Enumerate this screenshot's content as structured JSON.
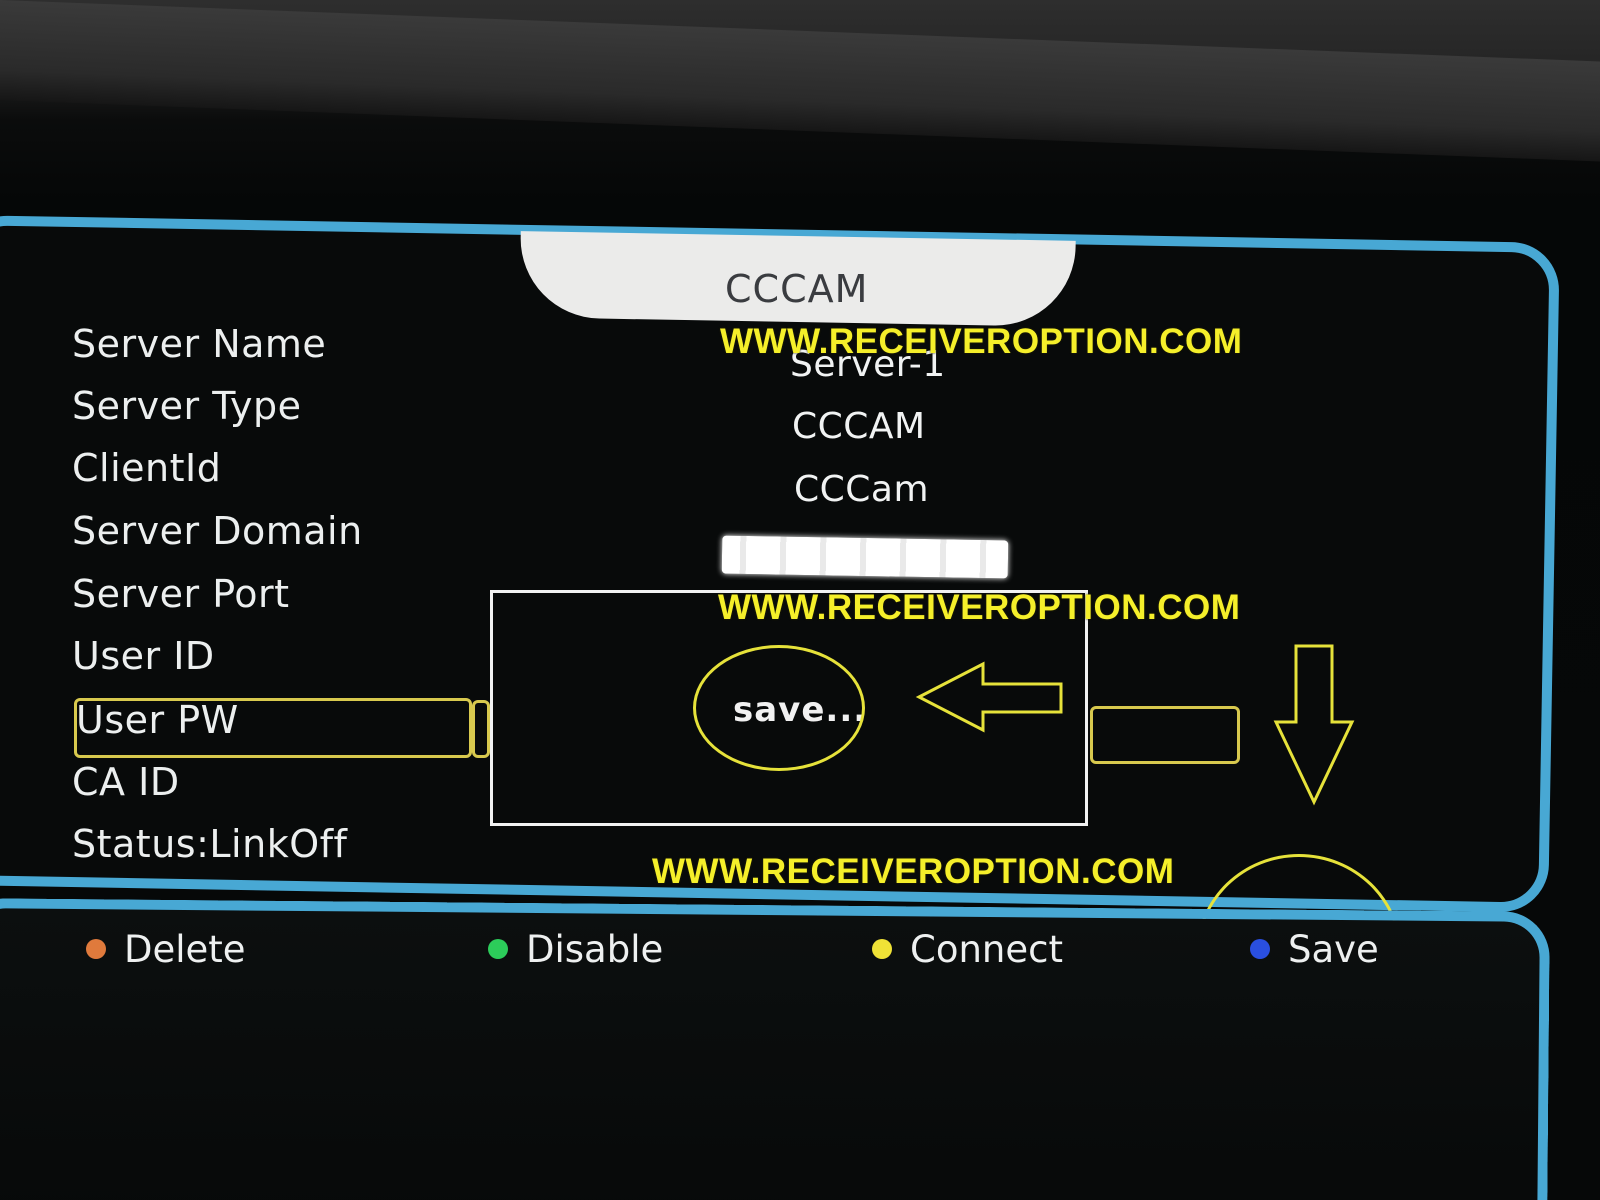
{
  "header": {
    "title": "CCCAM"
  },
  "watermark": "WWW.RECEIVEROPTION.COM",
  "fields": [
    {
      "label": "Server Name",
      "value": "Server-1"
    },
    {
      "label": "Server Type",
      "value": "CCCAM"
    },
    {
      "label": "ClientId",
      "value": "CCCam"
    },
    {
      "label": "Server Domain",
      "value": ""
    },
    {
      "label": "Server Port",
      "value": ""
    },
    {
      "label": "User ID",
      "value": ""
    },
    {
      "label": "User PW",
      "value": ""
    },
    {
      "label": "CA ID",
      "value": ""
    }
  ],
  "status": "Status:LinkOff",
  "dialog": {
    "message": "save..."
  },
  "footer": {
    "delete": {
      "label": "Delete",
      "color": "#e07a3c"
    },
    "disable": {
      "label": "Disable",
      "color": "#2ccc5a"
    },
    "connect": {
      "label": "Connect",
      "color": "#f0e236"
    },
    "save": {
      "label": "Save",
      "color": "#2a4fe0"
    }
  },
  "colors": {
    "panel_border": "#48a8d4",
    "highlight": "#d8c94e",
    "annotation": "#e6e23a"
  }
}
